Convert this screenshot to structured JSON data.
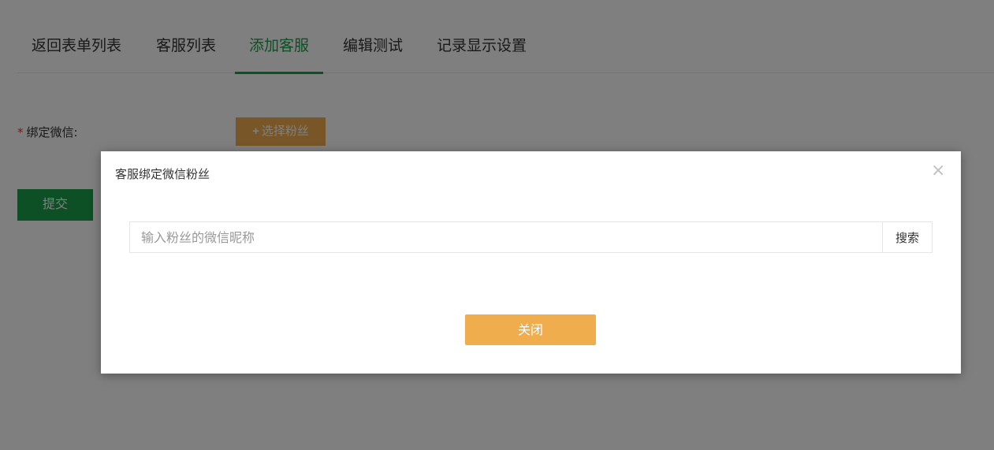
{
  "tabs": [
    {
      "label": "返回表单列表",
      "active": false
    },
    {
      "label": "客服列表",
      "active": false
    },
    {
      "label": "添加客服",
      "active": true
    },
    {
      "label": "编辑测试",
      "active": false
    },
    {
      "label": "记录显示设置",
      "active": false
    }
  ],
  "form": {
    "required_mark": "*",
    "bind_wechat_label": "绑定微信:",
    "select_fans_icon": "+",
    "select_fans_label": "选择粉丝",
    "submit_label": "提交"
  },
  "modal": {
    "title": "客服绑定微信粉丝",
    "close_icon": "×",
    "search_placeholder": "输入粉丝的微信昵称",
    "search_value": "",
    "search_button": "搜索",
    "close_button": "关闭"
  },
  "colors": {
    "accent_green": "#1aa04a",
    "accent_orange": "#f0ad4e"
  }
}
